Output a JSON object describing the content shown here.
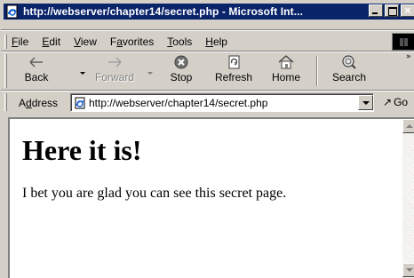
{
  "window": {
    "title": "http://webserver/chapter14/secret.php - Microsoft Int...",
    "icon": "ie-page-icon",
    "controls": {
      "minimize": "minimize-icon",
      "maximize": "maximize-icon",
      "close": "×"
    }
  },
  "menu": {
    "items": [
      {
        "pre": "",
        "key": "F",
        "post": "ile"
      },
      {
        "pre": "",
        "key": "E",
        "post": "dit"
      },
      {
        "pre": "",
        "key": "V",
        "post": "iew"
      },
      {
        "pre": "F",
        "key": "a",
        "post": "vorites"
      },
      {
        "pre": "",
        "key": "T",
        "post": "ools"
      },
      {
        "pre": "",
        "key": "H",
        "post": "elp"
      }
    ]
  },
  "toolbar": {
    "buttons": [
      {
        "label": "Back",
        "icon": "back-arrow-icon",
        "enabled": true
      },
      {
        "label": "Forward",
        "icon": "forward-arrow-icon",
        "enabled": false
      },
      {
        "label": "Stop",
        "icon": "stop-icon",
        "enabled": true
      },
      {
        "label": "Refresh",
        "icon": "refresh-icon",
        "enabled": true
      },
      {
        "label": "Home",
        "icon": "home-icon",
        "enabled": true
      },
      {
        "label": "Search",
        "icon": "search-icon",
        "enabled": true
      }
    ],
    "overflow": "»"
  },
  "address": {
    "label_pre": "A",
    "label_key": "d",
    "label_post": "dress",
    "value": "http://webserver/chapter14/secret.php",
    "go_label": "Go",
    "go_icon": "↗"
  },
  "page": {
    "heading": "Here it is!",
    "body": "I bet you are glad you can see this secret page."
  },
  "colors": {
    "titlebar": "#0a246a",
    "chrome": "#d4d0c8",
    "content_bg": "#ffffff"
  }
}
